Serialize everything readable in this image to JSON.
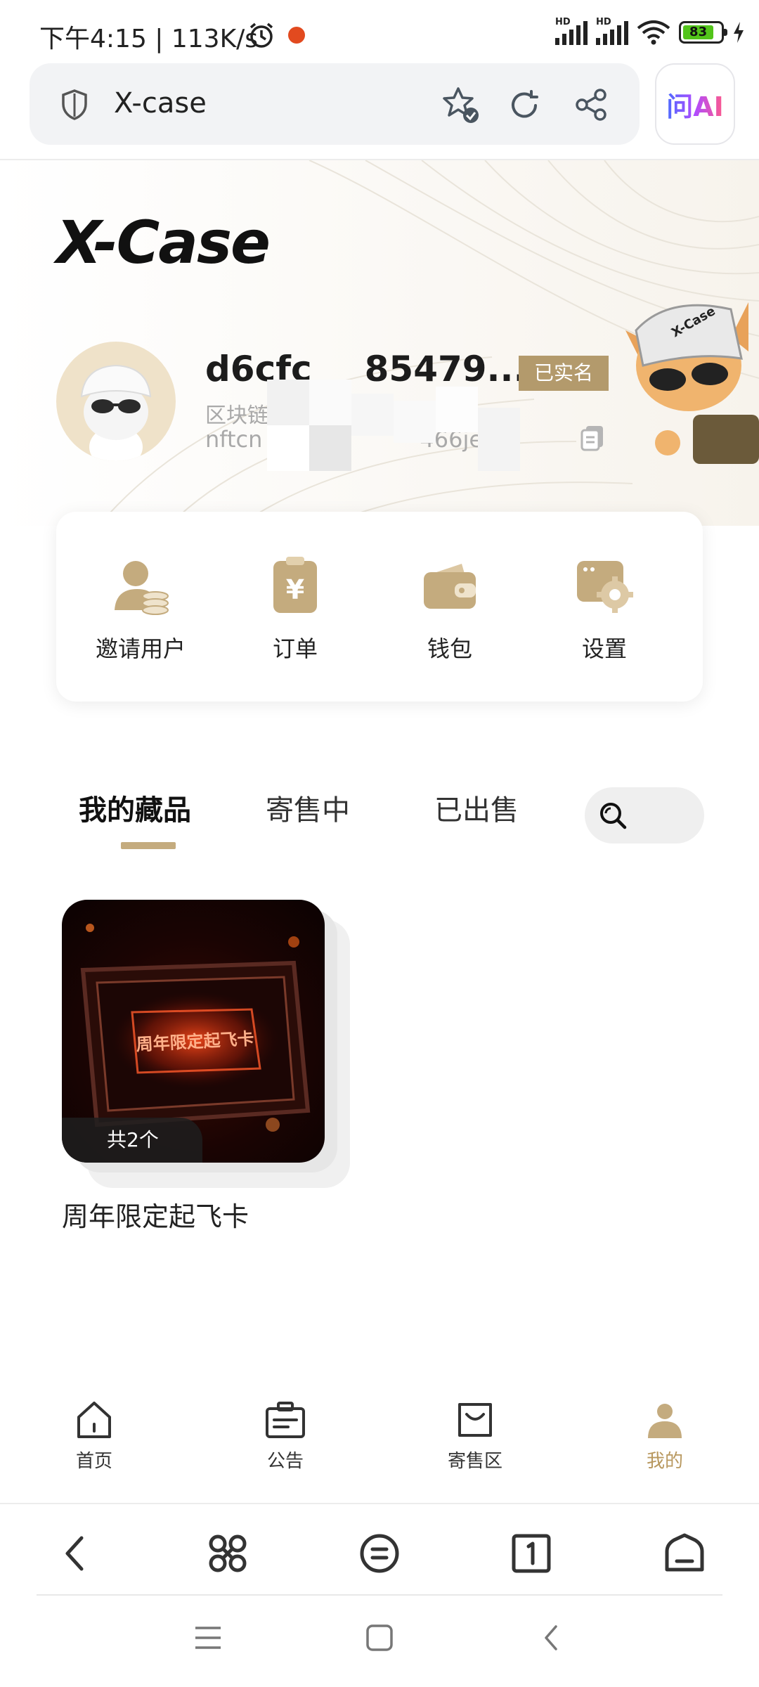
{
  "status_bar": {
    "time": "下午4:15 | 113K/s",
    "sim1_label": "HD",
    "sim2_label": "HD",
    "battery_level": "83"
  },
  "browser": {
    "url_text": "X-case",
    "ai_button_label": "问AI"
  },
  "profile": {
    "logo_text": "X-Case",
    "user_name": "d6cfc   85479...",
    "verified_badge": "已实名",
    "chain_label": "区块链",
    "chain_address": "nftcn              466jef"
  },
  "menu": {
    "items": [
      {
        "label": "邀请用户",
        "icon": "invite-user-icon"
      },
      {
        "label": "订单",
        "icon": "order-icon"
      },
      {
        "label": "钱包",
        "icon": "wallet-icon"
      },
      {
        "label": "设置",
        "icon": "settings-icon"
      }
    ]
  },
  "tabs": {
    "items": [
      "我的藏品",
      "寄售中",
      "已出售"
    ],
    "active_index": 0
  },
  "collection": {
    "items": [
      {
        "title": "周年限定起飞卡",
        "count_label": "共2个",
        "card_text": "周年限定起飞卡"
      }
    ]
  },
  "app_nav": {
    "items": [
      {
        "label": "首页",
        "icon": "home-icon"
      },
      {
        "label": "公告",
        "icon": "announcement-icon"
      },
      {
        "label": "寄售区",
        "icon": "consignment-bag-icon"
      },
      {
        "label": "我的",
        "icon": "profile-icon"
      }
    ],
    "active_index": 3
  },
  "colors": {
    "accent_gold": "#b8985f",
    "badge_bg": "#b39a6c",
    "battery_green": "#52c41a"
  }
}
